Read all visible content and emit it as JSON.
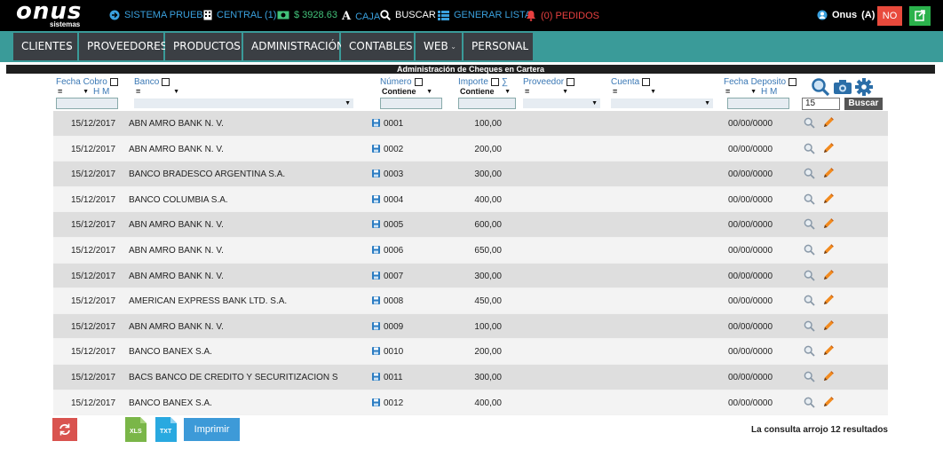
{
  "topbar": {
    "logo_text": "onus",
    "logo_sub": "sistemas",
    "company": "SISTEMA PRUEBA",
    "central": "CENTRAL (1)",
    "cash": "$ 3928.63",
    "caja": "CAJA",
    "buscar": "BUSCAR",
    "generar": "GENERAR LISTA",
    "pedidos": "(0) PEDIDOS",
    "user": "Onus",
    "user_role": "(A)",
    "no_label": "NO"
  },
  "nav": [
    "CLIENTES",
    "PROVEEDORES",
    "PRODUCTOS",
    "ADMINISTRACIÓN",
    "CONTABLES",
    "WEB",
    "PERSONAL"
  ],
  "section_title": "Administración de Cheques en Cartera",
  "filters": {
    "fecha_cobro": "Fecha Cobro",
    "banco": "Banco",
    "numero": "Número",
    "importe": "Importe",
    "sigma": "∑",
    "proveedor": "Proveedor",
    "cuenta": "Cuenta",
    "fecha_deposito": "Fecha Deposito",
    "eq": "=",
    "contiene": "Contiene",
    "hm": "H M",
    "limit": "15",
    "buscar_btn": "Buscar"
  },
  "rows": [
    {
      "fecha": "15/12/2017",
      "banco": "ABN AMRO BANK N. V.",
      "numero": "0001",
      "importe": "100,00",
      "fdep": "00/00/0000"
    },
    {
      "fecha": "15/12/2017",
      "banco": "ABN AMRO BANK N. V.",
      "numero": "0002",
      "importe": "200,00",
      "fdep": "00/00/0000"
    },
    {
      "fecha": "15/12/2017",
      "banco": "BANCO BRADESCO ARGENTINA S.A.",
      "numero": "0003",
      "importe": "300,00",
      "fdep": "00/00/0000"
    },
    {
      "fecha": "15/12/2017",
      "banco": "BANCO COLUMBIA S.A.",
      "numero": "0004",
      "importe": "400,00",
      "fdep": "00/00/0000"
    },
    {
      "fecha": "15/12/2017",
      "banco": "ABN AMRO BANK N. V.",
      "numero": "0005",
      "importe": "600,00",
      "fdep": "00/00/0000"
    },
    {
      "fecha": "15/12/2017",
      "banco": "ABN AMRO BANK N. V.",
      "numero": "0006",
      "importe": "650,00",
      "fdep": "00/00/0000"
    },
    {
      "fecha": "15/12/2017",
      "banco": "ABN AMRO BANK N. V.",
      "numero": "0007",
      "importe": "300,00",
      "fdep": "00/00/0000"
    },
    {
      "fecha": "15/12/2017",
      "banco": "AMERICAN EXPRESS BANK LTD. S.A.",
      "numero": "0008",
      "importe": "450,00",
      "fdep": "00/00/0000"
    },
    {
      "fecha": "15/12/2017",
      "banco": "ABN AMRO BANK N. V.",
      "numero": "0009",
      "importe": "100,00",
      "fdep": "00/00/0000"
    },
    {
      "fecha": "15/12/2017",
      "banco": "BANCO BANEX S.A.",
      "numero": "0010",
      "importe": "200,00",
      "fdep": "00/00/0000"
    },
    {
      "fecha": "15/12/2017",
      "banco": "BACS BANCO DE CREDITO Y SECURITIZACION S",
      "numero": "0011",
      "importe": "300,00",
      "fdep": "00/00/0000"
    },
    {
      "fecha": "15/12/2017",
      "banco": "BANCO BANEX S.A.",
      "numero": "0012",
      "importe": "400,00",
      "fdep": "00/00/0000"
    }
  ],
  "bottom": {
    "xls": "XLS",
    "txt": "TXT",
    "imprimir": "Imprimir",
    "result_prefix": "La consulta arrojo",
    "result_count": "12",
    "result_suffix": "resultados"
  }
}
